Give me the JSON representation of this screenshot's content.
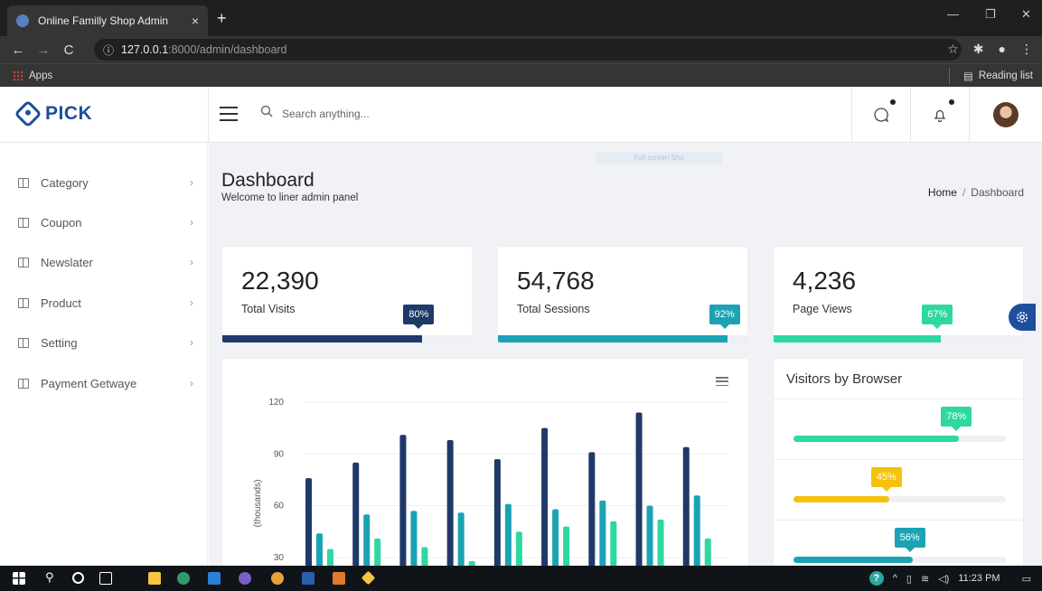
{
  "browser": {
    "tab_title": "Online Familly Shop Admin",
    "tab_close": "×",
    "new_tab": "+",
    "url_host": "127.0.0.1",
    "url_path": ":8000/admin/dashboard",
    "apps_label": "Apps",
    "reading_list_label": "Reading list"
  },
  "header": {
    "logo_text": "PICK",
    "search_placeholder": "Search anything..."
  },
  "sidebar": {
    "items": [
      {
        "label": "Category"
      },
      {
        "label": "Coupon"
      },
      {
        "label": "Newslater"
      },
      {
        "label": "Product"
      },
      {
        "label": "Setting"
      },
      {
        "label": "Payment Getwaye"
      }
    ]
  },
  "main": {
    "fullscreen_hint": "Full screen Sho",
    "title": "Dashboard",
    "subtitle": "Welcome to liner admin panel",
    "breadcrumb": {
      "home": "Home",
      "sep": "/",
      "current": "Dashboard"
    },
    "stats": [
      {
        "value": "22,390",
        "label": "Total Visits",
        "percent": 80,
        "percent_label": "80%",
        "color": "#1f3a68"
      },
      {
        "value": "54,768",
        "label": "Total Sessions",
        "percent": 92,
        "percent_label": "92%",
        "color": "#1ba3b4"
      },
      {
        "value": "4,236",
        "label": "Page Views",
        "percent": 67,
        "percent_label": "67%",
        "color": "#2ed8a0"
      }
    ],
    "browsers": {
      "title": "Visitors by Browser",
      "rows": [
        {
          "percent": 78,
          "percent_label": "78%",
          "color": "#2ed8a0"
        },
        {
          "percent": 45,
          "percent_label": "45%",
          "color": "#f4c20d"
        },
        {
          "percent": 56,
          "percent_label": "56%",
          "color": "#1ba3b4"
        }
      ]
    }
  },
  "chart_data": {
    "type": "bar",
    "ylabel": "(thousands)",
    "yticks": [
      30,
      60,
      90,
      120
    ],
    "ylim": [
      0,
      120
    ],
    "colors": [
      "#1f3a68",
      "#1ba3b4",
      "#2ed8a0"
    ],
    "groups": 9,
    "series": [
      {
        "values": [
          76,
          85,
          101,
          98,
          87,
          105,
          91,
          114,
          94
        ]
      },
      {
        "values": [
          44,
          55,
          57,
          56,
          61,
          58,
          63,
          60,
          66
        ]
      },
      {
        "values": [
          35,
          41,
          36,
          28,
          45,
          48,
          51,
          52,
          41
        ]
      }
    ]
  },
  "taskbar": {
    "time": "11:23 PM"
  }
}
